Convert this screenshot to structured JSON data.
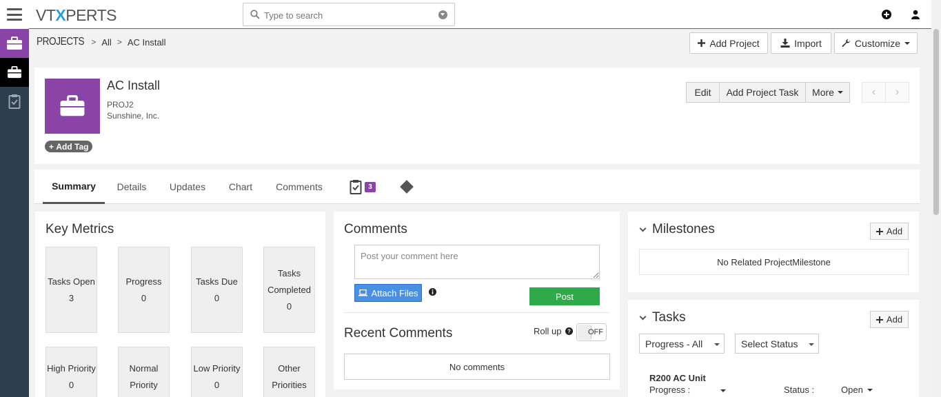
{
  "app": {
    "logo_left": "VT",
    "logo_x": "X",
    "logo_right": "PERTS"
  },
  "search": {
    "placeholder": "Type to search"
  },
  "breadcrumb": {
    "module": "PROJECTS",
    "filter": "All",
    "record": "AC Install"
  },
  "toolbar": {
    "add_project": "Add Project",
    "import": "Import",
    "customize": "Customize"
  },
  "record": {
    "title": "AC Install",
    "number": "PROJ2",
    "account": "Sunshine, Inc.",
    "add_tag": "Add Tag",
    "actions": {
      "edit": "Edit",
      "add_task": "Add Project Task",
      "more": "More"
    }
  },
  "tabs": {
    "summary": "Summary",
    "details": "Details",
    "updates": "Updates",
    "chart": "Chart",
    "comments": "Comments",
    "task_count": "3"
  },
  "key_metrics": {
    "title": "Key Metrics",
    "items": [
      {
        "label": "Tasks Open",
        "value": "3"
      },
      {
        "label": "Progress",
        "value": "0"
      },
      {
        "label": "Tasks Due",
        "value": "0"
      },
      {
        "label": "Tasks Completed",
        "value": "0"
      },
      {
        "label": "High Priority",
        "value": "0"
      },
      {
        "label": "Normal Priority",
        "value": "0"
      },
      {
        "label": "Low Priority",
        "value": "0"
      },
      {
        "label": "Other Priorities",
        "value": ""
      }
    ]
  },
  "comments": {
    "title": "Comments",
    "placeholder": "Post your comment here",
    "attach": "Attach Files",
    "post": "Post",
    "recent_title": "Recent Comments",
    "rollup": "Roll up",
    "toggle": "OFF",
    "empty": "No comments"
  },
  "milestones": {
    "title": "Milestones",
    "add": "Add",
    "empty": "No Related ProjectMilestone"
  },
  "tasks": {
    "title": "Tasks",
    "add": "Add",
    "progress_filter": "Progress - All",
    "status_filter": "Select Status",
    "item": {
      "name": "R200 AC Unit",
      "progress_label": "Progress :",
      "status_label": "Status :",
      "status": "Open"
    }
  },
  "colors": {
    "accent": "#8a44a8",
    "rail": "#2d3e4e",
    "post": "#2eaa4a",
    "attach": "#4a90e2"
  }
}
